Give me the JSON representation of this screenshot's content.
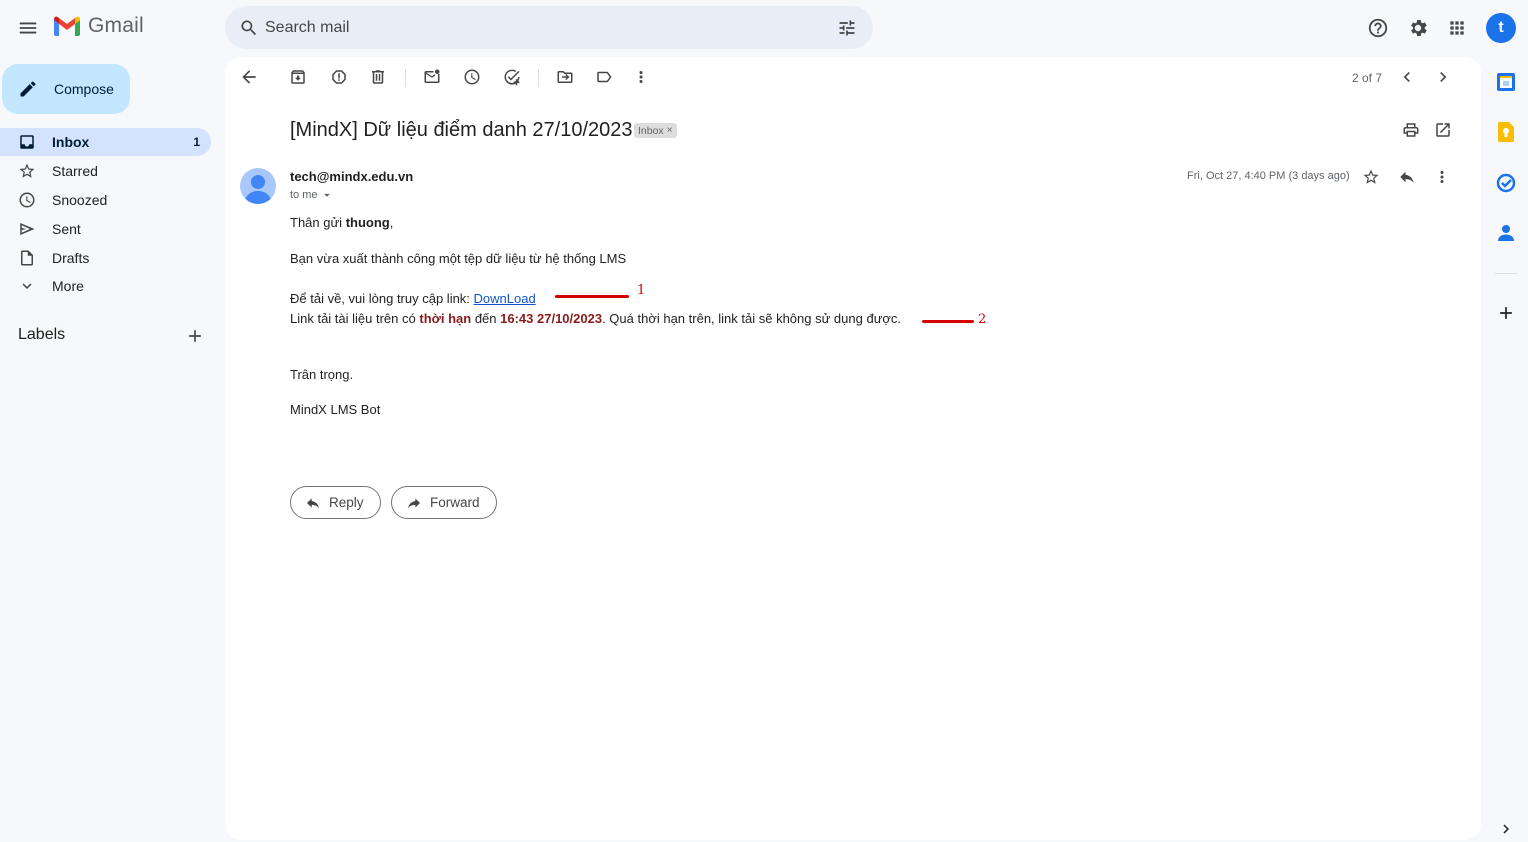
{
  "app": {
    "name": "Gmail"
  },
  "search": {
    "placeholder": "Search mail"
  },
  "account": {
    "initial": "t"
  },
  "sidebar": {
    "compose_label": "Compose",
    "items": [
      {
        "label": "Inbox",
        "icon": "inbox-icon",
        "count": "1",
        "active": true
      },
      {
        "label": "Starred",
        "icon": "star-icon"
      },
      {
        "label": "Snoozed",
        "icon": "clock-icon"
      },
      {
        "label": "Sent",
        "icon": "send-icon"
      },
      {
        "label": "Drafts",
        "icon": "draft-icon"
      },
      {
        "label": "More",
        "icon": "chevron-down-icon"
      }
    ],
    "labels_heading": "Labels"
  },
  "toolbar": {
    "pager": "2 of 7"
  },
  "email": {
    "subject": "[MindX] Dữ liệu điểm danh 27/10/2023",
    "label_chip": "Inbox",
    "chip_close": "×",
    "sender": "tech@mindx.edu.vn",
    "to": "to me",
    "date": "Fri, Oct 27, 4:40 PM (3 days ago)",
    "greeting_prefix": "Thân gửi ",
    "greeting_name": "thuong",
    "greeting_suffix": ",",
    "line1": "Bạn vừa xuất thành công một tệp dữ liệu từ hệ thống LMS",
    "line2_prefix": "Để tải về, vui lòng truy cập link: ",
    "line2_link": "DownLoad",
    "line3_a": "Link tải tài liệu trên có ",
    "line3_b": "thời hạn",
    "line3_c": " đến ",
    "line3_d": "16:43 27/10/2023",
    "line3_e": ". Quá thời hạn trên, link tải sẽ không sử dụng được.",
    "closing": "Trân trọng.",
    "signature": "MindX LMS Bot",
    "annotation_1": "1",
    "annotation_2": "2"
  },
  "actions": {
    "reply": "Reply",
    "forward": "Forward"
  },
  "colors": {
    "accent": "#0b57d0",
    "compose_bg": "#c2e7ff",
    "active_nav": "#d3e3fd",
    "annotation": "#d40000",
    "emphasis": "#8b1a1a"
  }
}
